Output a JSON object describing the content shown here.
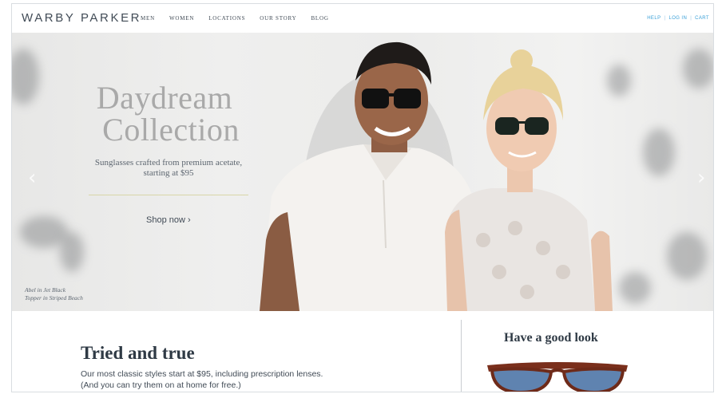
{
  "header": {
    "logo": "WARBY PARKER",
    "nav": [
      "MEN",
      "WOMEN",
      "LOCATIONS",
      "OUR STORY",
      "BLOG"
    ],
    "utility": [
      "HELP",
      "LOG IN",
      "CART"
    ],
    "separator": "|"
  },
  "hero": {
    "title_line1": "Daydream",
    "title_line2": "Collection",
    "subtitle": "Sunglasses crafted from premium acetate, starting at $95",
    "cta": "Shop now ›",
    "caption_line1": "Abel in Jet Black",
    "caption_line2": "Topper in Striped Beach",
    "prev_arrow": "‹",
    "next_arrow": "›"
  },
  "section_left": {
    "title": "Tried and true",
    "body_line1": "Our most classic styles start at $95, including prescription lenses.",
    "body_line2": "(And you can try them on at home for free.)"
  },
  "section_right": {
    "title": "Have a good look"
  },
  "colors": {
    "text": "#414b56",
    "link_blue": "#3aa0d8",
    "hero_bg": "#ececeb",
    "accent_rule": "#d8d6a8",
    "tortoise": "#7a2f1c",
    "lens_blue": "#5f83b0"
  },
  "icons": {
    "prev": "chevron-left-icon",
    "next": "chevron-right-icon",
    "cta_arrow": "chevron-right-icon"
  }
}
